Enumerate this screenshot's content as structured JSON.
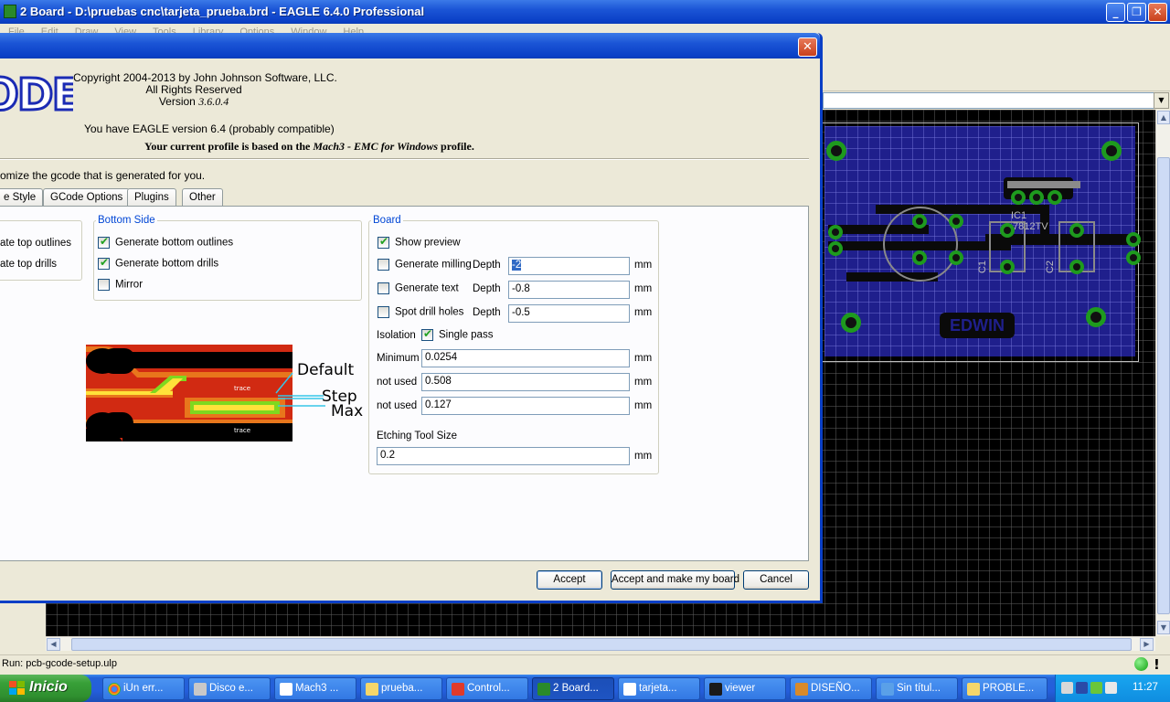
{
  "main_window": {
    "title": "2 Board - D:\\pruebas cnc\\tarjeta_prueba.brd - EAGLE 6.4.0 Professional",
    "menu": [
      "File",
      "Edit",
      "Draw",
      "View",
      "Tools",
      "Library",
      "Options",
      "Window",
      "Help"
    ]
  },
  "board": {
    "labels": {
      "ic1": "IC1",
      "ic_value": "7812TV",
      "c1": "C1",
      "c2": "C2",
      "edwin": "EDWIN"
    }
  },
  "status_bar": {
    "text": "Run: pcb-gcode-setup.ulp",
    "stop_glyph": "!"
  },
  "dialog": {
    "logo_text": "ODE",
    "copyright": "Copyright 2004-2013 by John Johnson Software, LLC.",
    "rights": "All Rights Reserved",
    "version_prefix": "Version",
    "version": "3.6.0.4",
    "eagle_version": "You have EAGLE version 6.4 (probably compatible)",
    "profile_prefix": "Your current profile is based on the",
    "profile_name": "Mach3 - EMC for Windows",
    "profile_suffix": "profile.",
    "customize_text": "omize the gcode that is generated for you.",
    "tabs": [
      "e Style",
      "GCode Options",
      "Plugins",
      "Other"
    ],
    "top_side": {
      "outlines": "ate top outlines",
      "drills": "ate top drills"
    },
    "bottom_side": {
      "legend": "Bottom Side",
      "outlines": {
        "label": "Generate bottom outlines",
        "checked": true
      },
      "drills": {
        "label": "Generate bottom drills",
        "checked": true
      },
      "mirror": {
        "label": "Mirror",
        "checked": false
      }
    },
    "board_group": {
      "legend": "Board",
      "show_preview": {
        "label": "Show preview",
        "checked": true
      },
      "milling": {
        "label": "Generate milling",
        "checked": false,
        "depth_label": "Depth",
        "value": "-2",
        "unit": "mm"
      },
      "text": {
        "label": "Generate text",
        "checked": false,
        "depth_label": "Depth",
        "value": "-0.8",
        "unit": "mm"
      },
      "spot": {
        "label": "Spot drill holes",
        "checked": false,
        "depth_label": "Depth",
        "value": "-0.5",
        "unit": "mm"
      },
      "isolation": {
        "label": "Isolation",
        "single_pass_label": "Single pass",
        "single_pass": true
      },
      "minimum": {
        "label": "Minimum",
        "value": "0.0254",
        "unit": "mm"
      },
      "not_used_1": {
        "label": "not used",
        "value": "0.508",
        "unit": "mm"
      },
      "not_used_2": {
        "label": "not used",
        "value": "0.127",
        "unit": "mm"
      },
      "etching": {
        "label": "Etching Tool Size",
        "value": "0.2",
        "unit": "mm"
      }
    },
    "preview_labels": {
      "default": "Default",
      "step": "Step",
      "max": "Max",
      "trace1": "trace",
      "trace2": "trace"
    },
    "buttons": {
      "accept": "Accept",
      "accept_make": "Accept and make my board",
      "cancel": "Cancel"
    }
  },
  "taskbar": {
    "start_label": "Inicio",
    "tasks": [
      "iUn err...",
      "Disco e...",
      "Mach3 ...",
      "prueba...",
      "Control...",
      "2 Board...",
      "tarjeta...",
      "viewer",
      "DISEÑO...",
      "Sin títul...",
      "PROBLE..."
    ],
    "active_task": "2 Board...",
    "clock": "11:27"
  },
  "colors": {
    "titlebar_blue": "#0a3fc6",
    "group_legend": "#0046d5",
    "pcb_blue": "#1f1f8c",
    "pad_green": "#1e9a1e",
    "start_green": "#38a038"
  }
}
